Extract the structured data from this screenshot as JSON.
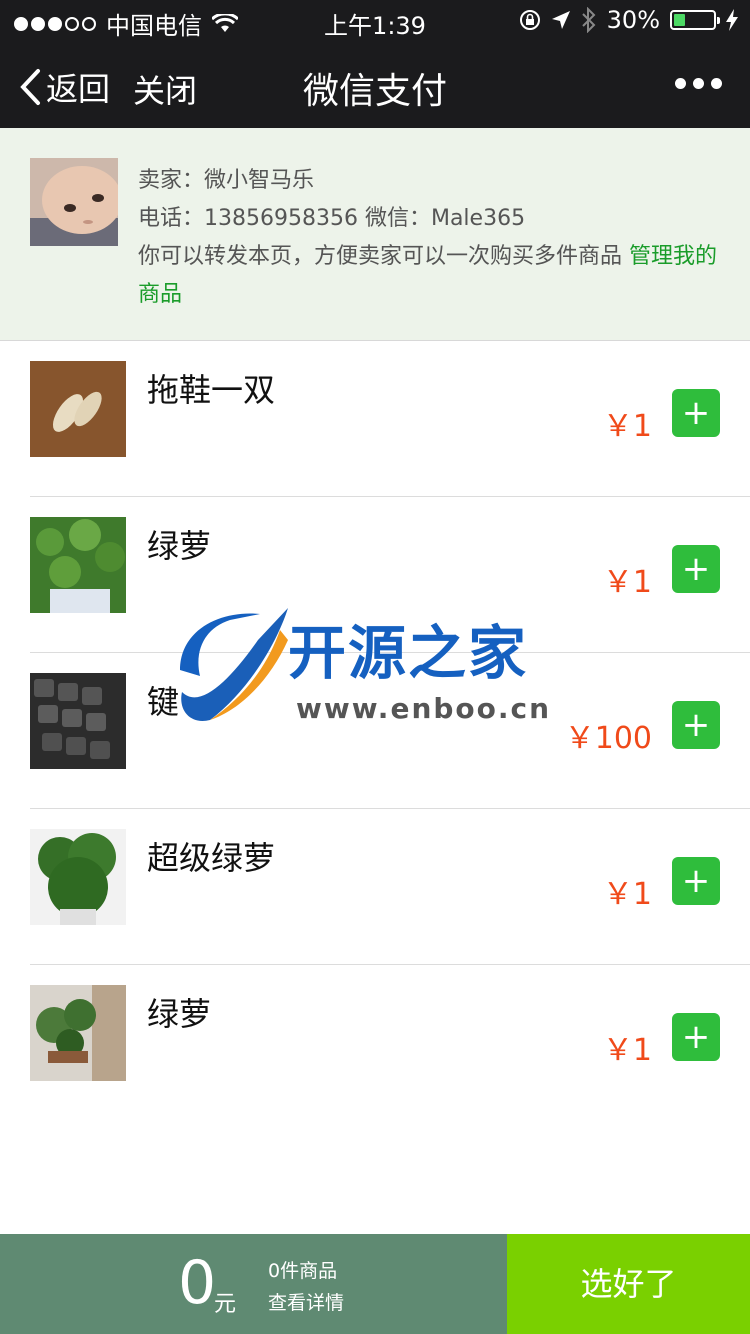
{
  "status_bar": {
    "carrier": "中国电信",
    "time": "上午1:39",
    "battery_percent": "30%",
    "battery_level": 0.3,
    "signal_bars": 3
  },
  "nav": {
    "back_label": "返回",
    "close_label": "关闭",
    "title": "微信支付"
  },
  "seller": {
    "name_line": "卖家：微小智马乐",
    "contact_line": "电话：13856958356 微信：Male365",
    "note": "你可以转发本页，方便卖家可以一次购买多件商品",
    "manage_link": "管理我的商品"
  },
  "products": [
    {
      "name": "拖鞋一双",
      "price": "￥1",
      "thumb_color": "#7a4b26"
    },
    {
      "name": "绿萝",
      "price": "￥1",
      "thumb_color": "#3f7a2c"
    },
    {
      "name": "键",
      "price": "￥100",
      "thumb_color": "#2c2c2c"
    },
    {
      "name": "超级绿萝",
      "price": "￥1",
      "thumb_color": "#356f27"
    },
    {
      "name": "绿萝",
      "price": "￥1",
      "thumb_color": "#4c7a3a"
    }
  ],
  "add_symbol": "+",
  "watermark": {
    "brand": "开源之家",
    "url": "www.enboo.cn"
  },
  "bottom": {
    "amount": "0",
    "unit": "元",
    "count_label": "0件商品",
    "detail_label": "查看详情",
    "confirm_label": "选好了"
  },
  "colors": {
    "price": "#f04a1a",
    "add_button": "#2fbd3c",
    "confirm_button": "#7ad000",
    "summary_bg": "#5f8a72"
  }
}
